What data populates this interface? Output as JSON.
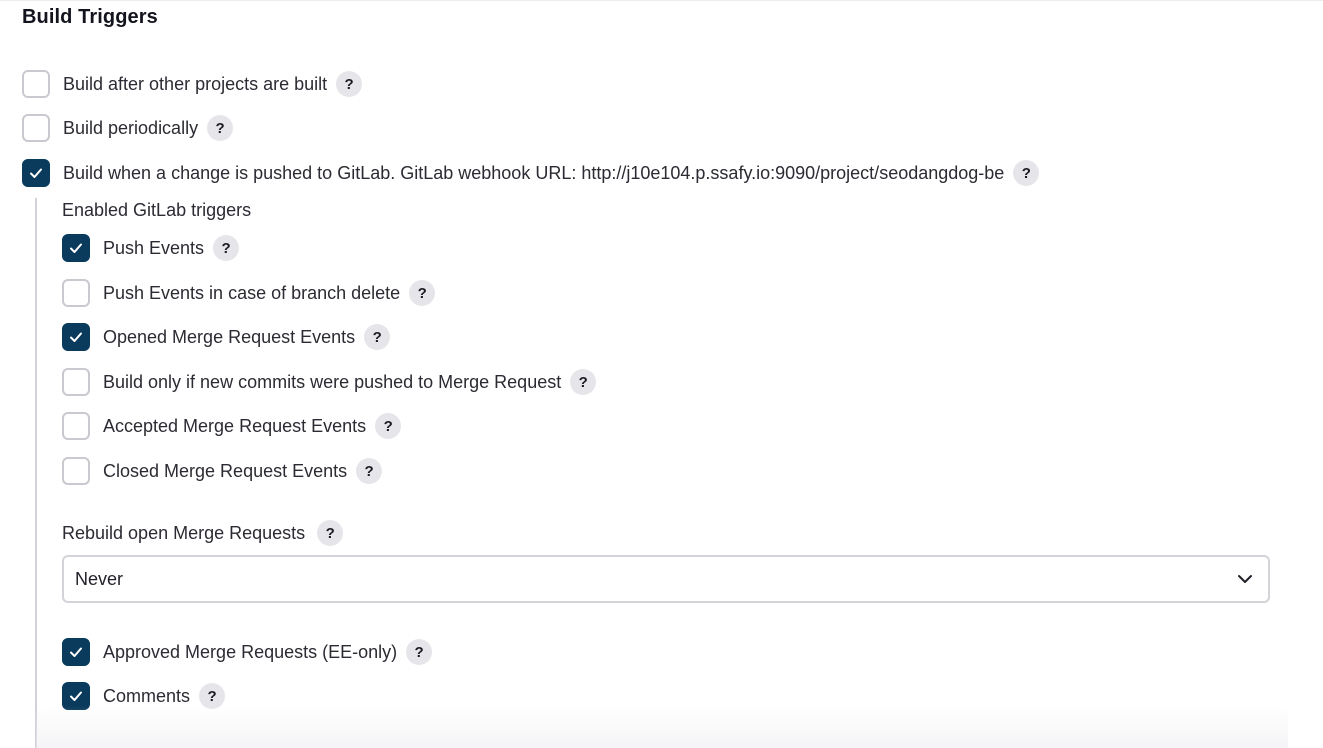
{
  "section": {
    "title": "Build Triggers"
  },
  "triggers": [
    {
      "label": "Build after other projects are built",
      "checked": false
    },
    {
      "label": "Build periodically",
      "checked": false
    },
    {
      "label": "Build when a change is pushed to GitLab. GitLab webhook URL: http://j10e104.p.ssafy.io:9090/project/seodangdog-be",
      "checked": true
    }
  ],
  "gitlab": {
    "heading": "Enabled GitLab triggers",
    "options": [
      {
        "label": "Push Events",
        "checked": true
      },
      {
        "label": "Push Events in case of branch delete",
        "checked": false
      },
      {
        "label": "Opened Merge Request Events",
        "checked": true
      },
      {
        "label": "Build only if new commits were pushed to Merge Request",
        "checked": false
      },
      {
        "label": "Accepted Merge Request Events",
        "checked": false
      },
      {
        "label": "Closed Merge Request Events",
        "checked": false
      }
    ],
    "rebuild": {
      "label": "Rebuild open Merge Requests",
      "selected": "Never"
    },
    "extra_options": [
      {
        "label": "Approved Merge Requests (EE-only)",
        "checked": true
      },
      {
        "label": "Comments",
        "checked": true
      }
    ]
  },
  "help_glyph": "?",
  "colors": {
    "checkbox_checked": "#0b3b5c",
    "checkbox_border": "#c9c9cf",
    "help_badge": "#e6e6ea"
  }
}
